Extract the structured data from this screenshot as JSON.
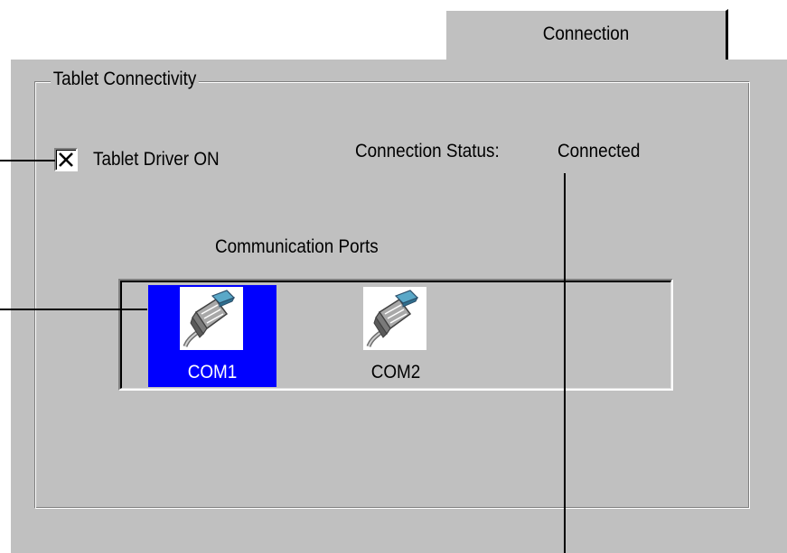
{
  "tabs": [
    {
      "label": "Connection",
      "active": true
    }
  ],
  "group": {
    "title": "Tablet Connectivity"
  },
  "driver_checkbox": {
    "label": "Tablet Driver ON",
    "checked": true
  },
  "status": {
    "label": "Connection Status:",
    "value": "Connected"
  },
  "ports": {
    "title": "Communication Ports",
    "items": [
      {
        "label": "COM1",
        "selected": true,
        "icon": "serial-connector-icon"
      },
      {
        "label": "COM2",
        "selected": false,
        "icon": "serial-connector-icon"
      }
    ]
  },
  "colors": {
    "face": "#c0c0c0",
    "selection": "#0000ff",
    "selection_text": "#ffffff",
    "text": "#000000"
  }
}
